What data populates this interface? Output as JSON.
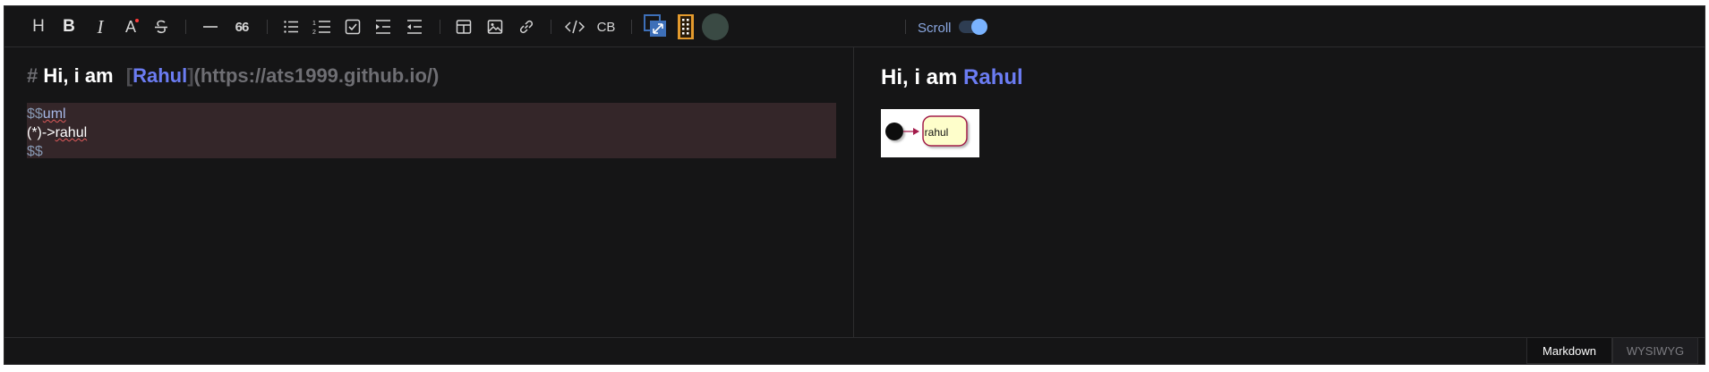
{
  "toolbar": {
    "items": [
      "heading-icon",
      "bold-icon",
      "italic-icon",
      "font-color-icon",
      "strikethrough-icon",
      "horizontal-rule-icon",
      "quote-icon",
      "bullet-list-icon",
      "ordered-list-icon",
      "checklist-icon",
      "indent-icon",
      "outdent-icon",
      "table-icon",
      "image-icon",
      "link-icon",
      "code-icon",
      "codeblock-icon",
      "fullscreen-icon",
      "mindmap-icon",
      "theme-moon-icon"
    ],
    "heading_glyph": "H",
    "bold_glyph": "B",
    "italic_glyph": "I",
    "fontcolor_glyph": "A",
    "quote_glyph": "66",
    "codeblock_label": "CB",
    "scroll_label": "Scroll",
    "scroll_on": true,
    "accent": "#7ab3ff"
  },
  "editor": {
    "heading_hash": "#",
    "heading_text": "Hi, i am",
    "link_open": "[",
    "link_text": "Rahul",
    "link_close": "]",
    "link_url": "(https://ats1999.github.io/)",
    "code_open_dollar": "$$",
    "code_lang": "uml",
    "code_body_prefix": "(*)->",
    "code_body_word": "rahul",
    "code_close": "$$"
  },
  "preview": {
    "heading_text": "Hi, i am",
    "heading_link": "Rahul",
    "uml_node_label": "rahul",
    "link_color": "#6b7cf2"
  },
  "status": {
    "tab_markdown": "Markdown",
    "tab_wysiwyg": "WYSIWYG",
    "active_tab": "Markdown"
  }
}
